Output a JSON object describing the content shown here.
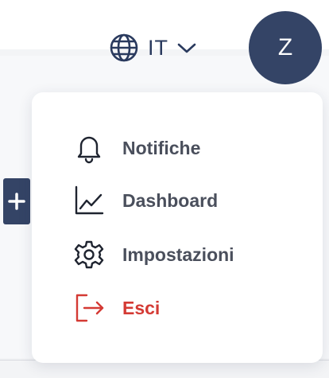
{
  "header": {
    "language": {
      "code": "IT",
      "icon": "globe-icon",
      "chevron": "chevron-down-icon"
    },
    "avatar": {
      "initial": "Z"
    }
  },
  "side_button": {
    "icon": "plus-icon"
  },
  "menu": {
    "items": [
      {
        "label": "Notifiche",
        "icon": "bell-icon"
      },
      {
        "label": "Dashboard",
        "icon": "chart-line-icon"
      },
      {
        "label": "Impostazioni",
        "icon": "gear-icon"
      },
      {
        "label": "Esci",
        "icon": "logout-icon"
      }
    ]
  },
  "colors": {
    "primary": "#344466",
    "text": "#4a4f5c",
    "danger": "#d43a34",
    "background": "#f3f4f6"
  }
}
